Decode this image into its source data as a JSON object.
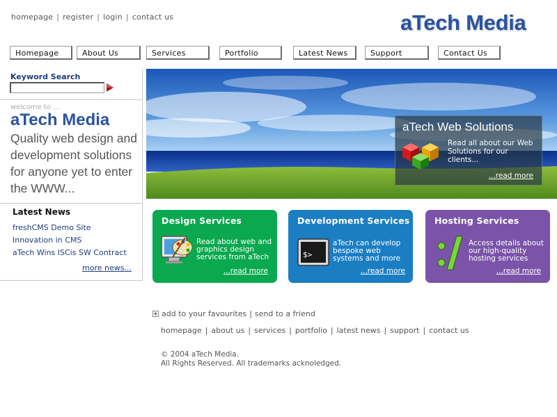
{
  "top_links": [
    "homepage",
    "register",
    "login",
    "contact us"
  ],
  "logo": "aTech Media",
  "nav": [
    "Homepage",
    "About Us",
    "Services",
    "Portfolio",
    "Latest News",
    "Support",
    "Contact Us"
  ],
  "search": {
    "title": "Keyword Search",
    "value": "",
    "go_icon": "arrow-right-icon"
  },
  "sidebar": {
    "welcome": "welcome to ...",
    "brand": "aTech Media",
    "tagline": "Quality web design and development solutions for anyone yet to enter the WWW...",
    "news_title": "Latest News",
    "news": [
      "freshCMS Demo Site",
      "Innovation in CMS",
      "aTech Wins ISCis SW Contract"
    ],
    "more_news": "more news..."
  },
  "hero": {
    "title": "aTech Web Solutions",
    "text": "Read all about our Web Solutions for our clients...",
    "link": "...read more"
  },
  "services": [
    {
      "title": "Design Services",
      "text": "Read about web and graphics design services from aTech",
      "link": "...read more",
      "color": "#0aa84f",
      "icon": "palette-icon"
    },
    {
      "title": "Development Services",
      "text": "aTech can develop bespoke web systems and more",
      "link": "...read more",
      "color": "#1b7ec3",
      "icon": "terminal-icon"
    },
    {
      "title": "Hosting Services",
      "text": "Access details about our high-quality hosting services",
      "link": "...read more",
      "color": "#7b53a9",
      "icon": "colon-slash-icon"
    }
  ],
  "favourites": [
    "add to your favourites",
    "send to a friend"
  ],
  "footer_links": [
    "homepage",
    "about us",
    "services",
    "portfolio",
    "latest news",
    "support",
    "contact us"
  ],
  "copyright": [
    "© 2004 aTech Media.",
    "All Rights Reserved. All trademarks acknoledged."
  ]
}
